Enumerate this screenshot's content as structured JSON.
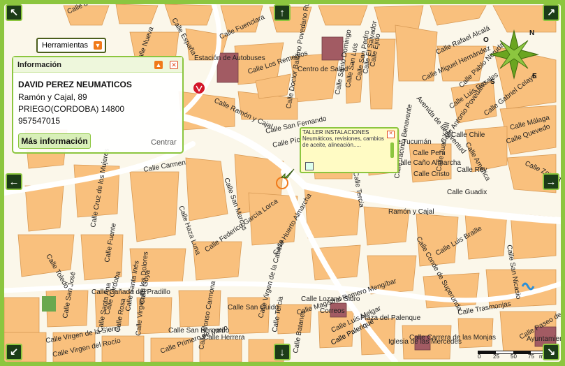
{
  "toolbar": {
    "tools_label": "Herramientas",
    "dropdown_glyph": "▼"
  },
  "info_panel": {
    "title": "Información",
    "business_name": "DAVID PEREZ NEUMATICOS",
    "address": "Ramón y Cajal, 89",
    "city": "PRIEGO(CORDOBA) 14800",
    "phone": "957547015",
    "more_label": "Más información",
    "center_label": "Centrar",
    "minimize_glyph": "▲",
    "close_glyph": "✕"
  },
  "tooltip": {
    "title": "TALLER INSTALACIONES",
    "description": "Neumáticos, revisiones, cambios de aceite, alineación.....",
    "close_glyph": "✕"
  },
  "nav": {
    "up": "↑",
    "down": "↓",
    "left": "←",
    "right": "→",
    "nw": "↖",
    "ne": "↗",
    "sw": "↙",
    "se": "↘"
  },
  "compass": {
    "n": "N",
    "e": "E",
    "s": "S",
    "o": "O"
  },
  "scale": {
    "ticks": [
      "0",
      "25",
      "50",
      "75"
    ],
    "unit": "m"
  },
  "street_labels": [
    "Calle Rafael Alcalá",
    "Calle del Rosario",
    "Calle Fuenclara",
    "Calle España",
    "Calle Zorrilla",
    "Calle Los Remedios",
    "Calle Ramón y Cajal",
    "Calle Carmen",
    "Calle Haza Luna",
    "Calle San Marcos",
    "Calle Federico García Lorca",
    "Calle Huerto Almarcha",
    "Calle San Fernando",
    "Calle Pío XII",
    "Ramón y Cajal",
    "Calle Tucumán",
    "Calle Tercia",
    "Calle Caño Almarcha",
    "Calle Cañada del Pradillo",
    "Calle San Guido",
    "Calle Virgen de la Cabeza",
    "Calle Lozano Sidro",
    "Calle Magistral Romero Mengíbar",
    "Calle Palenque",
    "Calle Carrera de las Monjas",
    "Calle Trasmonjas",
    "Calle Luis Braille",
    "Calle San Nicasio",
    "Calle Cristo",
    "Calle Rey",
    "Calle Guadix",
    "Calle Perú",
    "Calle Jacinto Benavente",
    "Calle Conde de Superunda",
    "Calle Juan XXIII",
    "Calle Chile",
    "Calle América",
    "Calle Antonio Povedano",
    "Calle Quevedo",
    "Calle Gabriel Celaya",
    "Calle Pablo Neruda",
    "Calle Miguel Hernández",
    "Calle Luis Rosales",
    "Avenida de la Juventud",
    "Calle Málaga",
    "Calle Doctor Balbino Povedano Ruiz",
    "Calle Santo Domingo",
    "Calle San Luis",
    "Calle San Pedro",
    "Calle El Salvador",
    "Calle Ejido",
    "Calle Nueva",
    "Calle Córdoba",
    "Calle Santa Ana",
    "Calle Rosa",
    "Calle Santa Inés",
    "Calle Goya",
    "Calle San José",
    "Calle Virgen de los Dolores",
    "Calle Virgen del Rocío",
    "Calle Virgen de la Sierra",
    "Calle Alonso Carmona",
    "Calle Herrera",
    "Calle San Bernardo",
    "Calle Toledo",
    "Calle Cruz de los Mujeres",
    "Calle Fuente",
    "Calle Primero de Mayo",
    "Calle Palenque",
    "Calle Tercia",
    "Calle Batanes",
    "Calle Luis Melgar",
    "Calle Paseo de Colombia"
  ],
  "pois": {
    "bus_station": "Estación de Autobuses",
    "health_center": "Centro de Salud",
    "post_office": "Correos",
    "square": "Plaza del Palenque",
    "church": "Iglesia de las Mercedes",
    "town_hall": "Ayuntamiento"
  },
  "colors": {
    "frame": "#8cc63f",
    "block": "#f9c07d",
    "block_stroke": "#d89a55",
    "street": "#ffffff",
    "special": "#a25b63",
    "park": "#6aa84f",
    "accent": "#f07a1a"
  },
  "icons": [
    "compass-rose-icon",
    "motorway-pin-icon",
    "movistar-logo-icon",
    "location-arrow-icon",
    "edit-icon"
  ]
}
